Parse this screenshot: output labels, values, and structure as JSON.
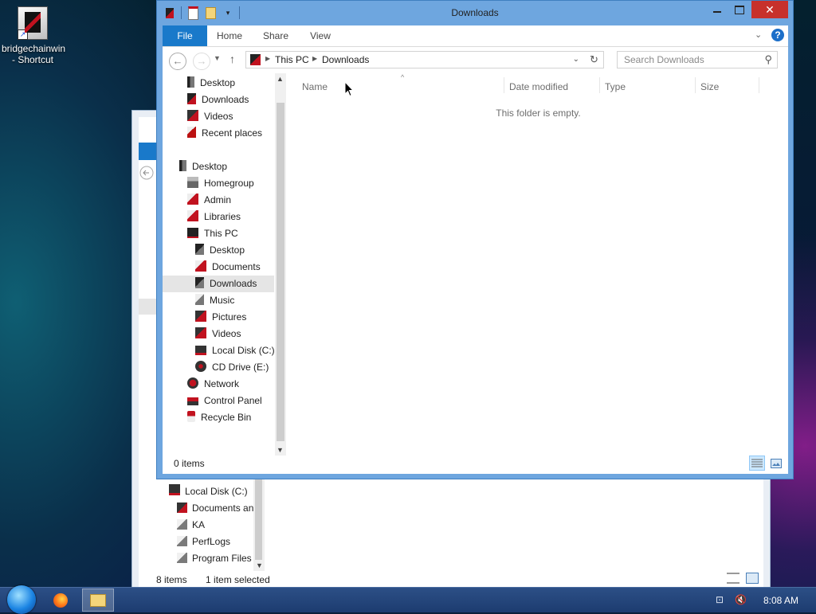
{
  "desktop": {
    "icons": [
      {
        "label_line1": "bridgechainwin",
        "label_line2": "- Shortcut",
        "icon": "shortcut-app-icon"
      }
    ]
  },
  "background_window": {
    "tree": [
      {
        "label": "Local Disk (C:)",
        "icon": "drive-icon"
      },
      {
        "label": "Documents an",
        "icon": "folder-icon"
      },
      {
        "label": "KA",
        "icon": "folder-icon"
      },
      {
        "label": "PerfLogs",
        "icon": "folder-icon"
      },
      {
        "label": "Program Files",
        "icon": "folder-icon"
      }
    ],
    "status": {
      "items": "8 items",
      "selected": "1 item selected"
    }
  },
  "window": {
    "title": "Downloads",
    "quick_access": [
      "properties-icon",
      "new-folder-icon",
      "customize-dropdown-icon"
    ],
    "ribbon_tabs": [
      "File",
      "Home",
      "Share",
      "View"
    ],
    "address": {
      "root": "This PC",
      "current": "Downloads"
    },
    "search_placeholder": "Search Downloads",
    "nav_pane": [
      {
        "label": "Desktop",
        "icon": "desktop-icon",
        "level": 1
      },
      {
        "label": "Downloads",
        "icon": "downloads-icon",
        "level": 1
      },
      {
        "label": "Videos",
        "icon": "videos-icon",
        "level": 1
      },
      {
        "label": "Recent places",
        "icon": "recent-places-icon",
        "level": 1
      },
      {
        "label": "Desktop",
        "icon": "desktop-icon",
        "level": 0
      },
      {
        "label": "Homegroup",
        "icon": "homegroup-icon",
        "level": 1
      },
      {
        "label": "Admin",
        "icon": "user-folder-icon",
        "level": 1
      },
      {
        "label": "Libraries",
        "icon": "libraries-icon",
        "level": 1
      },
      {
        "label": "This PC",
        "icon": "computer-icon",
        "level": 1
      },
      {
        "label": "Desktop",
        "icon": "desktop-icon",
        "level": 2
      },
      {
        "label": "Documents",
        "icon": "documents-icon",
        "level": 2
      },
      {
        "label": "Downloads",
        "icon": "downloads-icon",
        "level": 2,
        "selected": true
      },
      {
        "label": "Music",
        "icon": "music-icon",
        "level": 2
      },
      {
        "label": "Pictures",
        "icon": "pictures-icon",
        "level": 2
      },
      {
        "label": "Videos",
        "icon": "videos-icon",
        "level": 2
      },
      {
        "label": "Local Disk (C:)",
        "icon": "drive-icon",
        "level": 2
      },
      {
        "label": "CD Drive (E:)",
        "icon": "cd-drive-icon",
        "level": 2
      },
      {
        "label": "Network",
        "icon": "network-icon",
        "level": 1
      },
      {
        "label": "Control Panel",
        "icon": "control-panel-icon",
        "level": 1
      },
      {
        "label": "Recycle Bin",
        "icon": "recycle-bin-icon",
        "level": 1
      }
    ],
    "columns": [
      "Name",
      "Date modified",
      "Type",
      "Size"
    ],
    "empty_message": "This folder is empty.",
    "status": "0 items"
  },
  "taskbar": {
    "apps": [
      "start-orb-icon",
      "firefox-icon",
      "file-explorer-icon"
    ],
    "tray_icons": [
      "network-icon",
      "volume-muted-icon"
    ],
    "time": "8:08 AM"
  },
  "colors": {
    "title_bar": "#6ea6df",
    "file_tab": "#1979ca",
    "close_button": "#c7312b",
    "taskbar": "#1d3c70",
    "selected_nav": "#e5e5e5"
  }
}
